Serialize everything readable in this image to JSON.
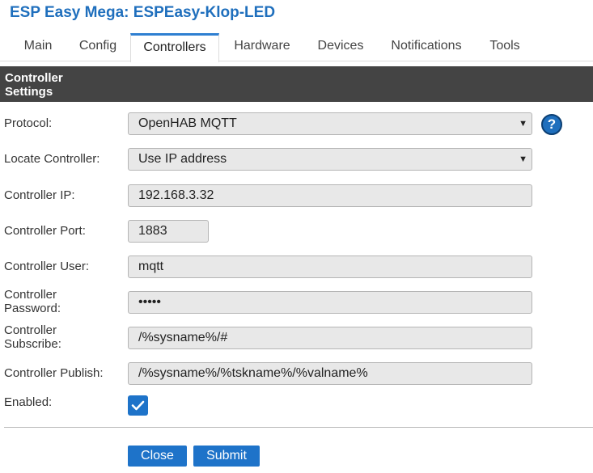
{
  "title": "ESP Easy Mega: ESPEasy-Klop-LED",
  "tabs": [
    "Main",
    "Config",
    "Controllers",
    "Hardware",
    "Devices",
    "Notifications",
    "Tools"
  ],
  "active_tab": "Controllers",
  "section": {
    "title": "Controller Settings"
  },
  "form": {
    "protocol": {
      "label": "Protocol:",
      "value": "OpenHAB MQTT"
    },
    "locate": {
      "label": "Locate Controller:",
      "value": "Use IP address"
    },
    "ip": {
      "label": "Controller IP:",
      "value": "192.168.3.32"
    },
    "port": {
      "label": "Controller Port:",
      "value": "1883"
    },
    "user": {
      "label": "Controller User:",
      "value": "mqtt"
    },
    "password": {
      "label": "Controller Password:",
      "value": "•••••"
    },
    "subscribe": {
      "label": "Controller Subscribe:",
      "value": "/%sysname%/#"
    },
    "publish": {
      "label": "Controller Publish:",
      "value": "/%sysname%/%tskname%/%valname%"
    },
    "enabled": {
      "label": "Enabled:",
      "checked": true
    }
  },
  "help_symbol": "?",
  "buttons": {
    "close": "Close",
    "submit": "Submit"
  },
  "colors": {
    "accent": "#1e73c9",
    "title": "#1f6fbd",
    "header_bg": "#444444"
  },
  "icons": {
    "select_arrow": "triangle-down-icon",
    "check": "checkmark-icon",
    "help": "help-icon"
  }
}
